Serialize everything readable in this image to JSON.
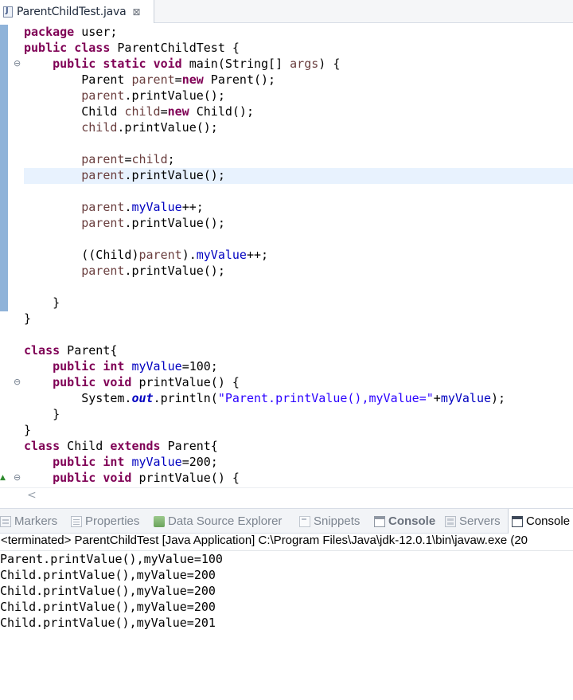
{
  "editor_tab": {
    "label": "ParentChildTest.java",
    "close": "⊠"
  },
  "code_lines": [
    "package user;",
    "public class ParentChildTest {",
    "    public static void main(String[] args) {",
    "        Parent parent=new Parent();",
    "        parent.printValue();",
    "        Child child=new Child();",
    "        child.printValue();",
    "",
    "        parent=child;",
    "        parent.printValue();",
    "",
    "        parent.myValue++;",
    "        parent.printValue();",
    "",
    "        ((Child)parent).myValue++;",
    "        parent.printValue();",
    "",
    "    }",
    "}",
    "",
    "class Parent{",
    "    public int myValue=100;",
    "    public void printValue() {",
    "        System.out.println(\"Parent.printValue(),myValue=\"+myValue);",
    "    }",
    "}",
    "class Child extends Parent{",
    "    public int myValue=200;",
    "    public void printValue() {"
  ],
  "current_line": 9,
  "view_tabs": [
    {
      "label": "Markers",
      "icon": "markers-icon"
    },
    {
      "label": "Properties",
      "icon": "properties-icon"
    },
    {
      "label": "Data Source Explorer",
      "icon": "data-source-explorer-icon"
    },
    {
      "label": "Snippets",
      "icon": "snippets-icon"
    },
    {
      "label": "Console",
      "icon": "console-icon"
    },
    {
      "label": "Servers",
      "icon": "servers-icon"
    },
    {
      "label": "Console",
      "icon": "console-icon"
    }
  ],
  "console": {
    "header": "<terminated> ParentChildTest [Java Application] C:\\Program Files\\Java\\jdk-12.0.1\\bin\\javaw.exe (20",
    "output": [
      "Parent.printValue(),myValue=100",
      "Child.printValue(),myValue=200",
      "Child.printValue(),myValue=200",
      "Child.printValue(),myValue=200",
      "Child.printValue(),myValue=201"
    ]
  },
  "colors": {
    "keyword": "#7f0055",
    "field": "#0000c0",
    "local_variable": "#6a3e3e",
    "string": "#2a00ff",
    "current_line_highlight": "#e8f2fe"
  }
}
